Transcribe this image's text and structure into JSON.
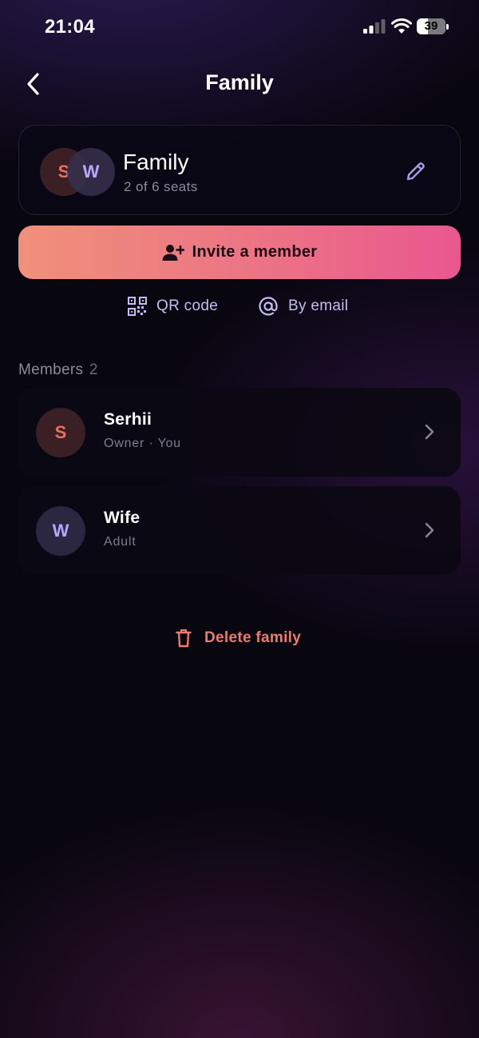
{
  "status_bar": {
    "time": "21:04",
    "battery": "39",
    "battery_level": 0.39
  },
  "header": {
    "title": "Family",
    "back_icon": "chevron-left-icon"
  },
  "family_card": {
    "name": "Family",
    "seats": "2 of 6 seats",
    "avatars": [
      "S",
      "W"
    ],
    "edit_icon": "pencil-icon"
  },
  "invite": {
    "label": "Invite a member",
    "icon": "add-person-icon"
  },
  "share_options": [
    {
      "label": "QR code",
      "icon": "qr-code-icon"
    },
    {
      "label": "By email",
      "icon": "at-sign-icon"
    }
  ],
  "members": {
    "heading": "Members",
    "count": "2",
    "items": [
      {
        "initial": "S",
        "name": "Serhii",
        "role": "Owner · You",
        "avatar_bg": "#3a1f25",
        "avatar_fg": "#e8715f"
      },
      {
        "initial": "W",
        "name": "Wife",
        "role": "Adult",
        "avatar_bg": "#2b2740",
        "avatar_fg": "#b9a6ff"
      }
    ]
  },
  "delete": {
    "label": "Delete family",
    "icon": "trash-icon"
  },
  "colors": {
    "accent_gradient_start": "#f0907a",
    "accent_gradient_end": "#e9578f",
    "danger": "#ec7b6e",
    "secondary_link": "#c7bdf3"
  }
}
